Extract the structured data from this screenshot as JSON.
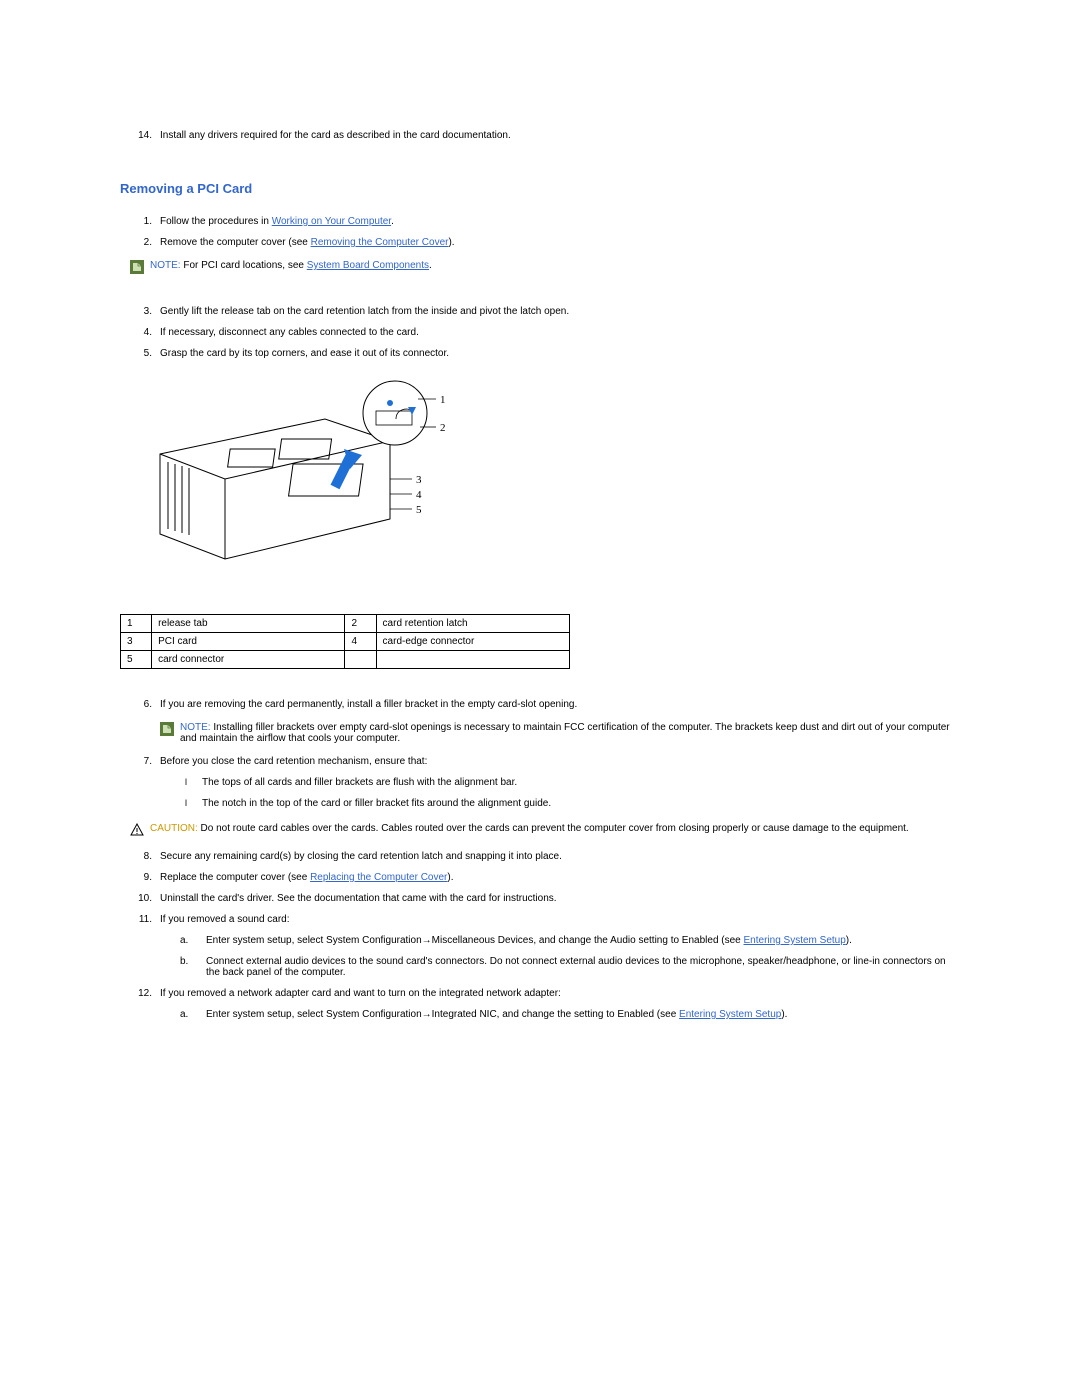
{
  "intro_step": {
    "num": "14.",
    "text": "Install any drivers required for the card as described in the card documentation."
  },
  "section_title": "Removing a PCI Card",
  "steps": {
    "s1": {
      "num": "1.",
      "prefix": "Follow the procedures in ",
      "link": "Working on Your Computer",
      "suffix": "."
    },
    "s2": {
      "num": "2.",
      "prefix": "Remove the computer cover (see ",
      "link": "Removing the Computer Cover",
      "suffix": ")."
    },
    "s3": {
      "num": "3.",
      "text": "Gently lift the release tab on the card retention latch from the inside and pivot the latch open."
    },
    "s4": {
      "num": "4.",
      "text": "If necessary, disconnect any cables connected to the card."
    },
    "s5": {
      "num": "5.",
      "text": "Grasp the card by its top corners, and ease it out of its connector."
    },
    "s6": {
      "num": "6.",
      "text": "If you are removing the card permanently, install a filler bracket in the empty card-slot opening."
    },
    "s7": {
      "num": "7.",
      "text": "Before you close the card retention mechanism, ensure that:"
    },
    "s7a": {
      "bullet": "l",
      "text": "The tops of all cards and filler brackets are flush with the alignment bar."
    },
    "s7b": {
      "bullet": "l",
      "text": "The notch in the top of the card or filler bracket fits around the alignment guide."
    },
    "s8": {
      "num": "8.",
      "text": "Secure any remaining card(s) by closing the card retention latch and snapping it into place."
    },
    "s9": {
      "num": "9.",
      "prefix": "Replace the computer cover (see ",
      "link": "Replacing the Computer Cover",
      "suffix": ")."
    },
    "s10": {
      "num": "10.",
      "text": "Uninstall the card's driver. See the documentation that came with the card for instructions."
    },
    "s11": {
      "num": "11.",
      "text": "If you removed a sound card:"
    },
    "s11a": {
      "letter": "a.",
      "prefix": "Enter system setup, select System Configuration→Miscellaneous Devices, and change the Audio setting to Enabled (see ",
      "link": "Entering System Setup",
      "suffix": ")."
    },
    "s11b": {
      "letter": "b.",
      "text": "Connect external audio devices to the sound card's connectors. Do not connect external audio devices to the microphone, speaker/headphone, or line-in connectors on the back panel of the computer."
    },
    "s12": {
      "num": "12.",
      "text": "If you removed a network adapter card and want to turn on the integrated network adapter:"
    },
    "s12a": {
      "letter": "a.",
      "prefix": "Enter system setup, select System Configuration→Integrated NIC, and change the setting to Enabled (see ",
      "link": "Entering System Setup",
      "suffix": ")."
    }
  },
  "note1": {
    "label": "NOTE:",
    "prefix": " For PCI card locations, see ",
    "link": "System Board Components",
    "suffix": "."
  },
  "note2": {
    "label": "NOTE:",
    "text": " Installing filler brackets over empty card-slot openings is necessary to maintain FCC certification of the computer. The brackets keep dust and dirt out of your computer and maintain the airflow that cools your computer."
  },
  "caution": {
    "label": "CAUTION:",
    "text": " Do not route card cables over the cards. Cables routed over the cards can prevent the computer cover from closing properly or cause damage to the equipment."
  },
  "table": {
    "r1c1": "1",
    "r1c2": "release tab",
    "r1c3": "2",
    "r1c4": "card retention latch",
    "r2c1": "3",
    "r2c2": "PCI card",
    "r2c3": "4",
    "r2c4": "card-edge connector",
    "r3c1": "5",
    "r3c2": "card connector"
  },
  "callouts": {
    "c1": "1",
    "c2": "2",
    "c3": "3",
    "c4": "4",
    "c5": "5"
  }
}
